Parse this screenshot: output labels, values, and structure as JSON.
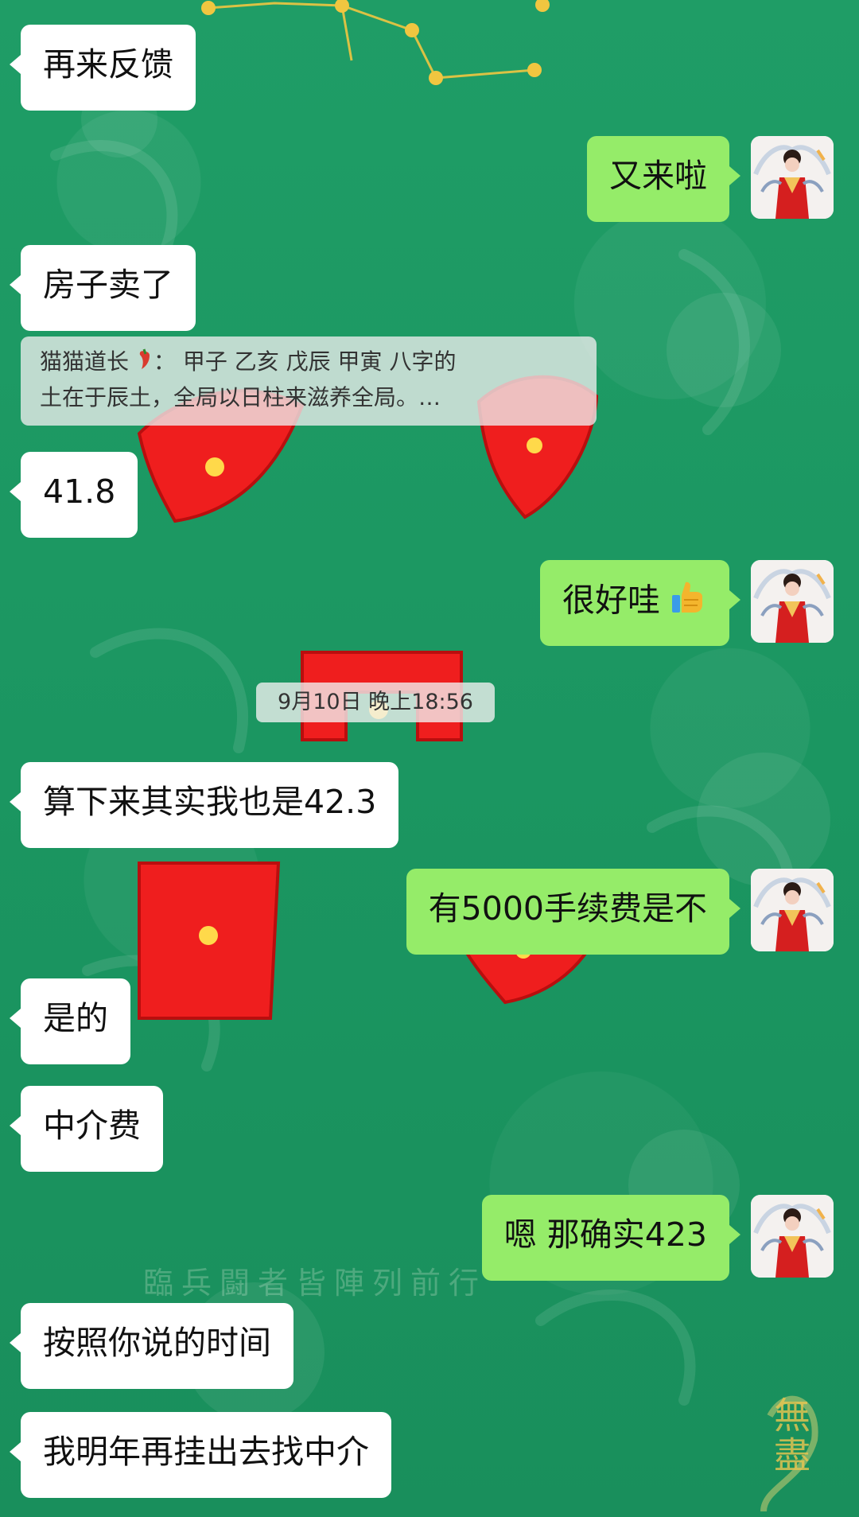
{
  "screen": {
    "width": 1080,
    "height": 1907
  },
  "background": {
    "watermark_text": "臨兵闘者皆陣列前行",
    "corner_text": "無盡"
  },
  "messages": [
    {
      "side": "left",
      "text": "再来反馈"
    },
    {
      "side": "right",
      "text": "又来啦"
    },
    {
      "side": "left",
      "text": "房子卖了"
    },
    {
      "side": "left",
      "text": "41.8"
    },
    {
      "side": "right",
      "text_prefix": "很好哇",
      "emoji": "thumbs-up"
    },
    {
      "side": "left",
      "text": "算下来其实我也是42.3"
    },
    {
      "side": "right",
      "text": "有5000手续费是不"
    },
    {
      "side": "left",
      "text": "是的"
    },
    {
      "side": "left",
      "text": "中介费"
    },
    {
      "side": "right",
      "text": "嗯 那确实423"
    },
    {
      "side": "left",
      "text": "按照你说的时间"
    },
    {
      "side": "left",
      "text": "我明年再挂出去找中介"
    }
  ],
  "quote": {
    "author": "猫猫道长",
    "separator": "：",
    "line1": "甲子 乙亥 戊辰 甲寅  八字的",
    "line2": "土在于辰土，全局以日柱来滋养全局。…",
    "emoji": "chili-pepper"
  },
  "timestamp": "9月10日 晚上18:56",
  "colors": {
    "chat_background": "#1e9a63",
    "left_bubble": "#ffffff",
    "right_bubble": "#95ec69",
    "quote_background": "#ededed",
    "time_badge": "#f2f2f2",
    "text": "#111111"
  }
}
